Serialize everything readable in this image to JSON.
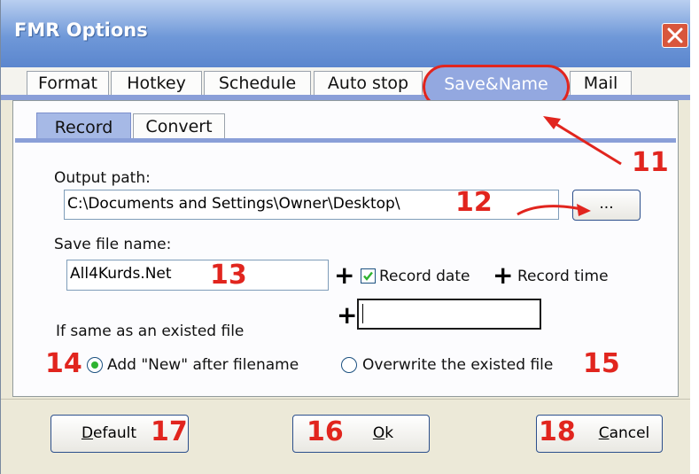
{
  "window": {
    "title": "FMR Options"
  },
  "tabs": {
    "main": [
      "Format",
      "Hotkey",
      "Schedule",
      "Auto stop",
      "Save&Name",
      "Mail"
    ],
    "sub": [
      "Record",
      "Convert"
    ]
  },
  "form": {
    "output_path_label": "Output path:",
    "output_path_value": "C:\\Documents and Settings\\Owner\\Desktop\\",
    "browse_label": "...",
    "save_file_name_label": "Save file name:",
    "file_name_value": "All4Kurds.Net",
    "plus_symbol": "+",
    "record_date_label": "Record date",
    "record_time_label": "Record time",
    "extra_text_value": "",
    "same_file_label": "If same as an existed file",
    "option_add_new_label": "Add \"New\" after filename",
    "option_overwrite_label": "Overwrite the existed file"
  },
  "buttons": {
    "default_label": "Default",
    "ok_label": "Ok",
    "cancel_label": "Cancel"
  },
  "annotations": {
    "n11": "11",
    "n12": "12",
    "n13": "13",
    "n14": "14",
    "n15": "15",
    "n16": "16",
    "n17": "17",
    "n18": "18"
  },
  "colors": {
    "annotation": "#e1251e",
    "accent": "#8a9fd8",
    "check": "#2fb32f"
  }
}
